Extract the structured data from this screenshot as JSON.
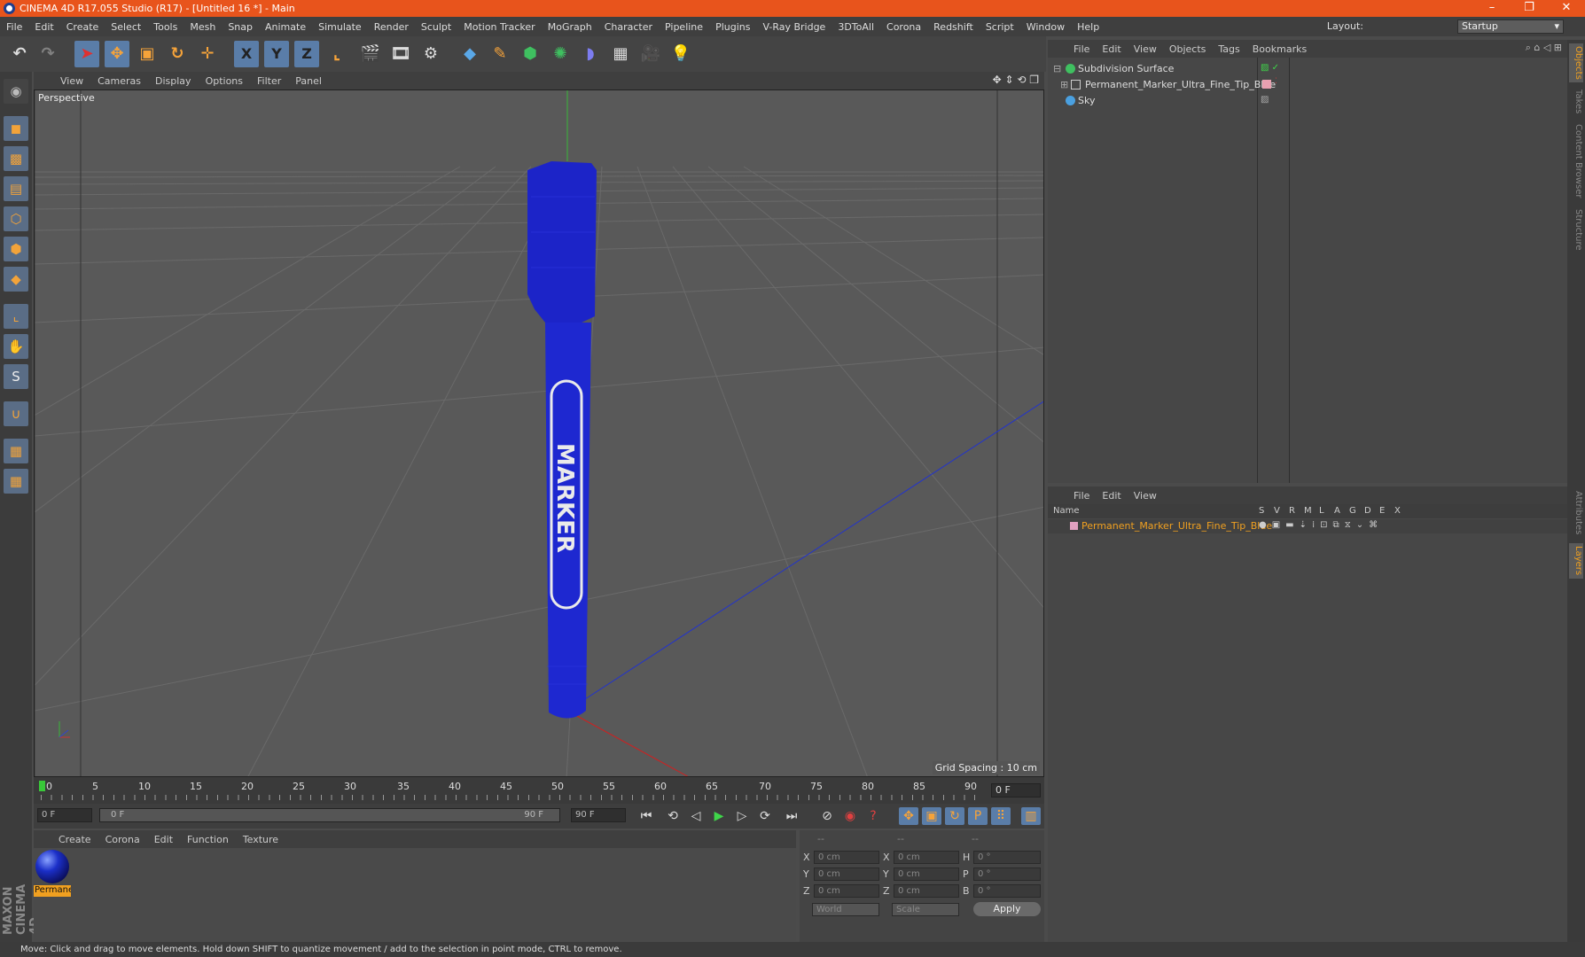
{
  "title_bar": {
    "title": "CINEMA 4D R17.055 Studio (R17) - [Untitled 16 *] - Main",
    "minimize": "–",
    "maximize": "❐",
    "close": "✕"
  },
  "menu": [
    "File",
    "Edit",
    "Create",
    "Select",
    "Tools",
    "Mesh",
    "Snap",
    "Animate",
    "Simulate",
    "Render",
    "Sculpt",
    "Motion Tracker",
    "MoGraph",
    "Character",
    "Pipeline",
    "Plugins",
    "V-Ray Bridge",
    "3DToAll",
    "Corona",
    "Redshift",
    "Script",
    "Window",
    "Help"
  ],
  "layout": {
    "label": "Layout:",
    "value": "Startup"
  },
  "toolbar": {
    "x_label": "X",
    "y_label": "Y",
    "z_label": "Z",
    "icons": [
      "undo-icon",
      "redo-icon",
      "select-pointer-icon",
      "move-icon",
      "scale-icon",
      "rotate-icon",
      "live-select-icon",
      "x-axis-icon",
      "y-axis-icon",
      "z-axis-icon",
      "coordinate-system-icon",
      "render-view-icon",
      "render-picture-viewer-icon",
      "render-settings-icon",
      "cube-object-icon",
      "pen-spline-icon",
      "subdivision-nurbs-icon",
      "array-cloner-icon",
      "deformer-icon",
      "floor-environment-icon",
      "camera-icon",
      "light-icon"
    ]
  },
  "viewport": {
    "menu": [
      "View",
      "Cameras",
      "Display",
      "Options",
      "Filter",
      "Panel"
    ],
    "label": "Perspective",
    "grid_spacing": "Grid Spacing : 10 cm",
    "marker_text": "MARKER",
    "marker_color": "#1c24c8"
  },
  "timeline": {
    "ticks": [
      "0",
      "5",
      "10",
      "15",
      "20",
      "25",
      "30",
      "35",
      "40",
      "45",
      "50",
      "55",
      "60",
      "65",
      "70",
      "75",
      "80",
      "85",
      "90"
    ],
    "current_frame": "0 F"
  },
  "transport": {
    "start_field": "0 F",
    "range_start": "0 F",
    "range_end": "90 F",
    "end_field": "90 F"
  },
  "material_manager": {
    "menu": [
      "Create",
      "Corona",
      "Edit",
      "Function",
      "Texture"
    ],
    "material_name": "Permanent_Marker_Ultra_Fine_Tip_Blue"
  },
  "coordinates": {
    "header": [
      "--",
      "--",
      "--"
    ],
    "rows": [
      {
        "a": "X",
        "av": "0 cm",
        "b": "X",
        "bv": "0 cm",
        "c": "H",
        "cv": "0 °"
      },
      {
        "a": "Y",
        "av": "0 cm",
        "b": "Y",
        "bv": "0 cm",
        "c": "P",
        "cv": "0 °"
      },
      {
        "a": "Z",
        "av": "0 cm",
        "b": "Z",
        "bv": "0 cm",
        "c": "B",
        "cv": "0 °"
      }
    ],
    "space": "World",
    "mode": "Scale",
    "apply": "Apply"
  },
  "object_manager": {
    "menu": [
      "File",
      "Edit",
      "View",
      "Objects",
      "Tags",
      "Bookmarks"
    ],
    "objects": [
      {
        "name": "Subdivision Surface",
        "color": "#3fc060"
      },
      {
        "name": "Permanent_Marker_Ultra_Fine_Tip_Blue",
        "color": "#c8c8c8"
      },
      {
        "name": "Sky",
        "color": "#4aa0e0"
      }
    ]
  },
  "layer_manager": {
    "menu": [
      "File",
      "Edit",
      "View"
    ],
    "columns": [
      "Name",
      "S",
      "V",
      "R",
      "M",
      "L",
      "A",
      "G",
      "D",
      "E",
      "X"
    ],
    "layer_name": "Permanent_Marker_Ultra_Fine_Tip_Blue",
    "layer_color": "#f0a020"
  },
  "side_tabs": [
    "Objects",
    "Takes",
    "Content Browser",
    "Structure",
    "Attributes",
    "Layers"
  ],
  "logo": "MAXON CINEMA 4D",
  "status": "Move: Click and drag to move elements. Hold down SHIFT to quantize movement / add to the selection in point mode, CTRL to remove."
}
